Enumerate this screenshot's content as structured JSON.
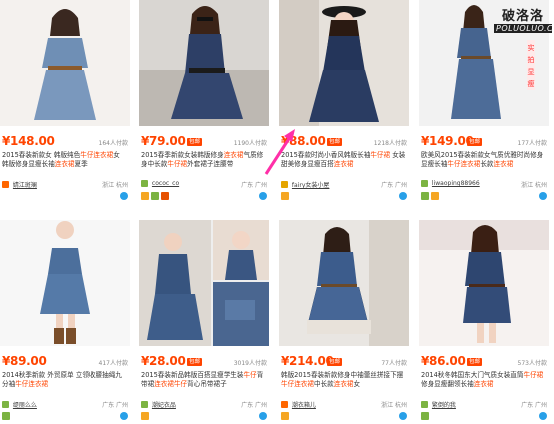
{
  "watermark": {
    "top": "破洛洛",
    "bottom": "POLUOLUO.COM"
  },
  "badge_label": "包邮",
  "cards": [
    {
      "price": "¥148.00",
      "sold": "164人付款",
      "badge": false,
      "title": "2015春装新款女 韩版纯色牛仔连衣裙女 韩版修身显瘦长袖连衣裙夏季",
      "shop": "婧江斑斓",
      "location": "浙江 杭州"
    },
    {
      "price": "¥79.00",
      "sold": "1190人付款",
      "badge": true,
      "title": "2015春季新款女装韩版修身连衣裙气质修身中长款牛仔裙外套裙子连腰带",
      "shop": "cococ_co",
      "location": "广东 广州"
    },
    {
      "price": "¥88.00",
      "sold": "1218人付款",
      "badge": true,
      "title": "2015春款时尚小香风韩版长袖牛仔裙 女装甜美修身显瘦百搭连衣裙",
      "shop": "fairy女装小屋",
      "location": "广东 广州"
    },
    {
      "price": "¥149.00",
      "sold": "177人付款",
      "badge": true,
      "title": "欧美风2015春装新款女气质优雅时尚修身显瘦长袖牛仔连衣裙长款连衣裙",
      "shop": "liwaoping88966",
      "location": "浙江 杭州"
    },
    {
      "price": "¥89.00",
      "sold": "417人付款",
      "badge": false,
      "title": "2014秋季新款 外贸原单 立领收腰抽绳九分袖牛仔连衣裙",
      "shop": "缇丽么么",
      "location": "广东 广州"
    },
    {
      "price": "¥28.00",
      "sold": "3019人付款",
      "badge": true,
      "title": "2015春装新品韩版百搭显瘦学生装牛仔背带裙连衣裙牛仔背心吊带裙子",
      "shop": "潮妃衣品",
      "location": "广东 广州"
    },
    {
      "price": "¥214.00",
      "sold": "77人付款",
      "badge": true,
      "title": "韩版2015春装新款修身中袖蕾丝拼接下摆牛仔连衣裙中长款连衣裙女",
      "shop": "潮衣箱儿",
      "location": "浙江 杭州"
    },
    {
      "price": "¥86.00",
      "sold": "573人付款",
      "badge": true,
      "title": "2014秋冬韩国东大门气质女装直筒牛仔裙修身显瘦翻领长袖连衣裙",
      "shop": "繁倒的我",
      "location": "广东 广州"
    }
  ],
  "colors": {
    "price": "#ff4400",
    "accent": "#ff4400",
    "wangwang": "#28a0e8",
    "arrow": "#ff2fa8"
  }
}
